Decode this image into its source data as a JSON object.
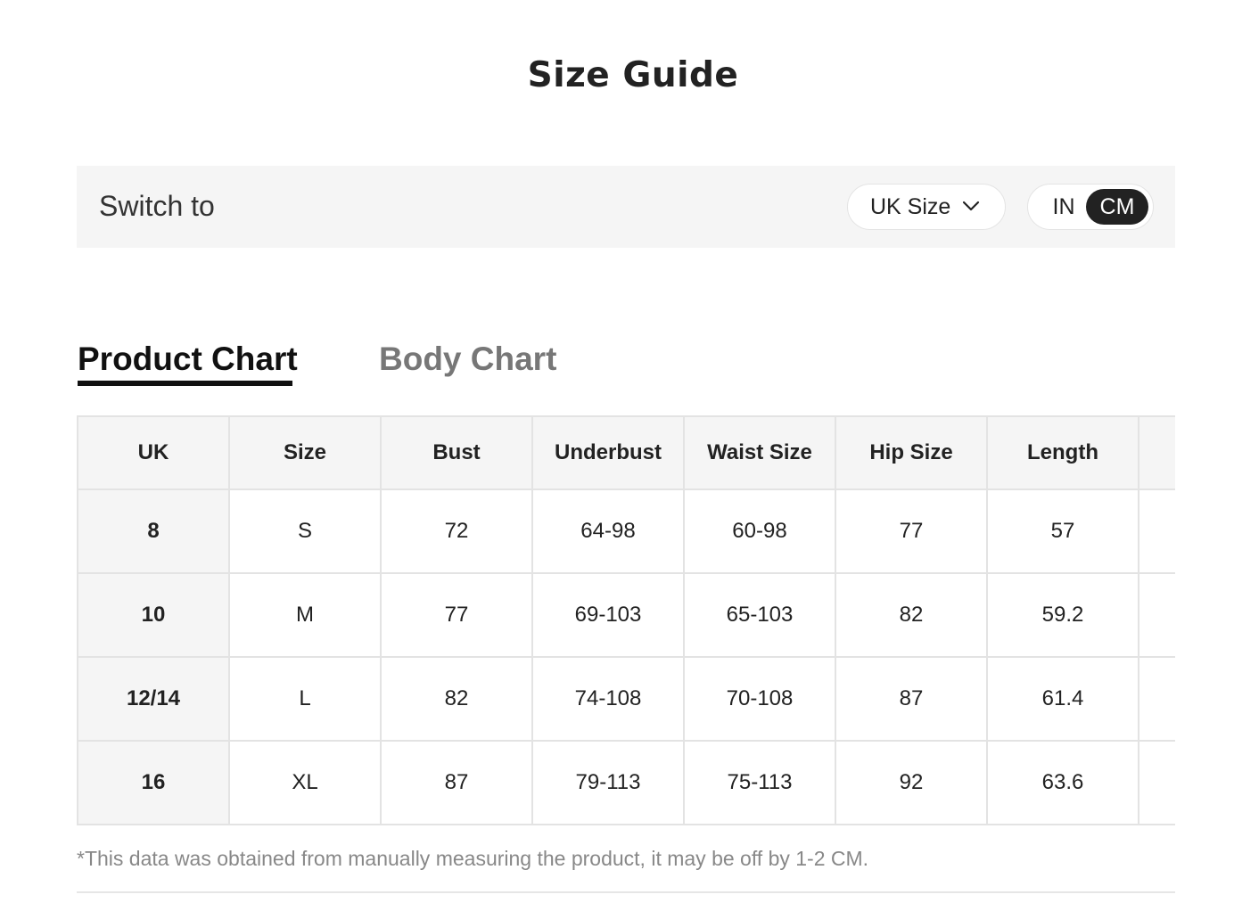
{
  "title": "Size Guide",
  "switch_bar": {
    "label": "Switch to",
    "size_system": "UK Size",
    "units": [
      "IN",
      "CM"
    ],
    "selected_unit": "CM"
  },
  "tabs": [
    {
      "label": "Product Chart",
      "active": true
    },
    {
      "label": "Body Chart",
      "active": false
    }
  ],
  "table": {
    "headers": [
      "UK",
      "Size",
      "Bust",
      "Underbust",
      "Waist Size",
      "Hip Size",
      "Length",
      ""
    ],
    "rows": [
      [
        "8",
        "S",
        "72",
        "64-98",
        "60-98",
        "77",
        "57",
        ""
      ],
      [
        "10",
        "M",
        "77",
        "69-103",
        "65-103",
        "82",
        "59.2",
        ""
      ],
      [
        "12/14",
        "L",
        "82",
        "74-108",
        "70-108",
        "87",
        "61.4",
        ""
      ],
      [
        "16",
        "XL",
        "87",
        "79-113",
        "75-113",
        "92",
        "63.6",
        ""
      ]
    ]
  },
  "footnote": "*This data was obtained from manually measuring the product, it may be off by 1-2 CM.",
  "colors": {
    "accent": "#222222",
    "panel": "#f5f5f5",
    "muted_text": "#888888"
  },
  "icons": {
    "dropdown": "chevron-down-icon"
  }
}
